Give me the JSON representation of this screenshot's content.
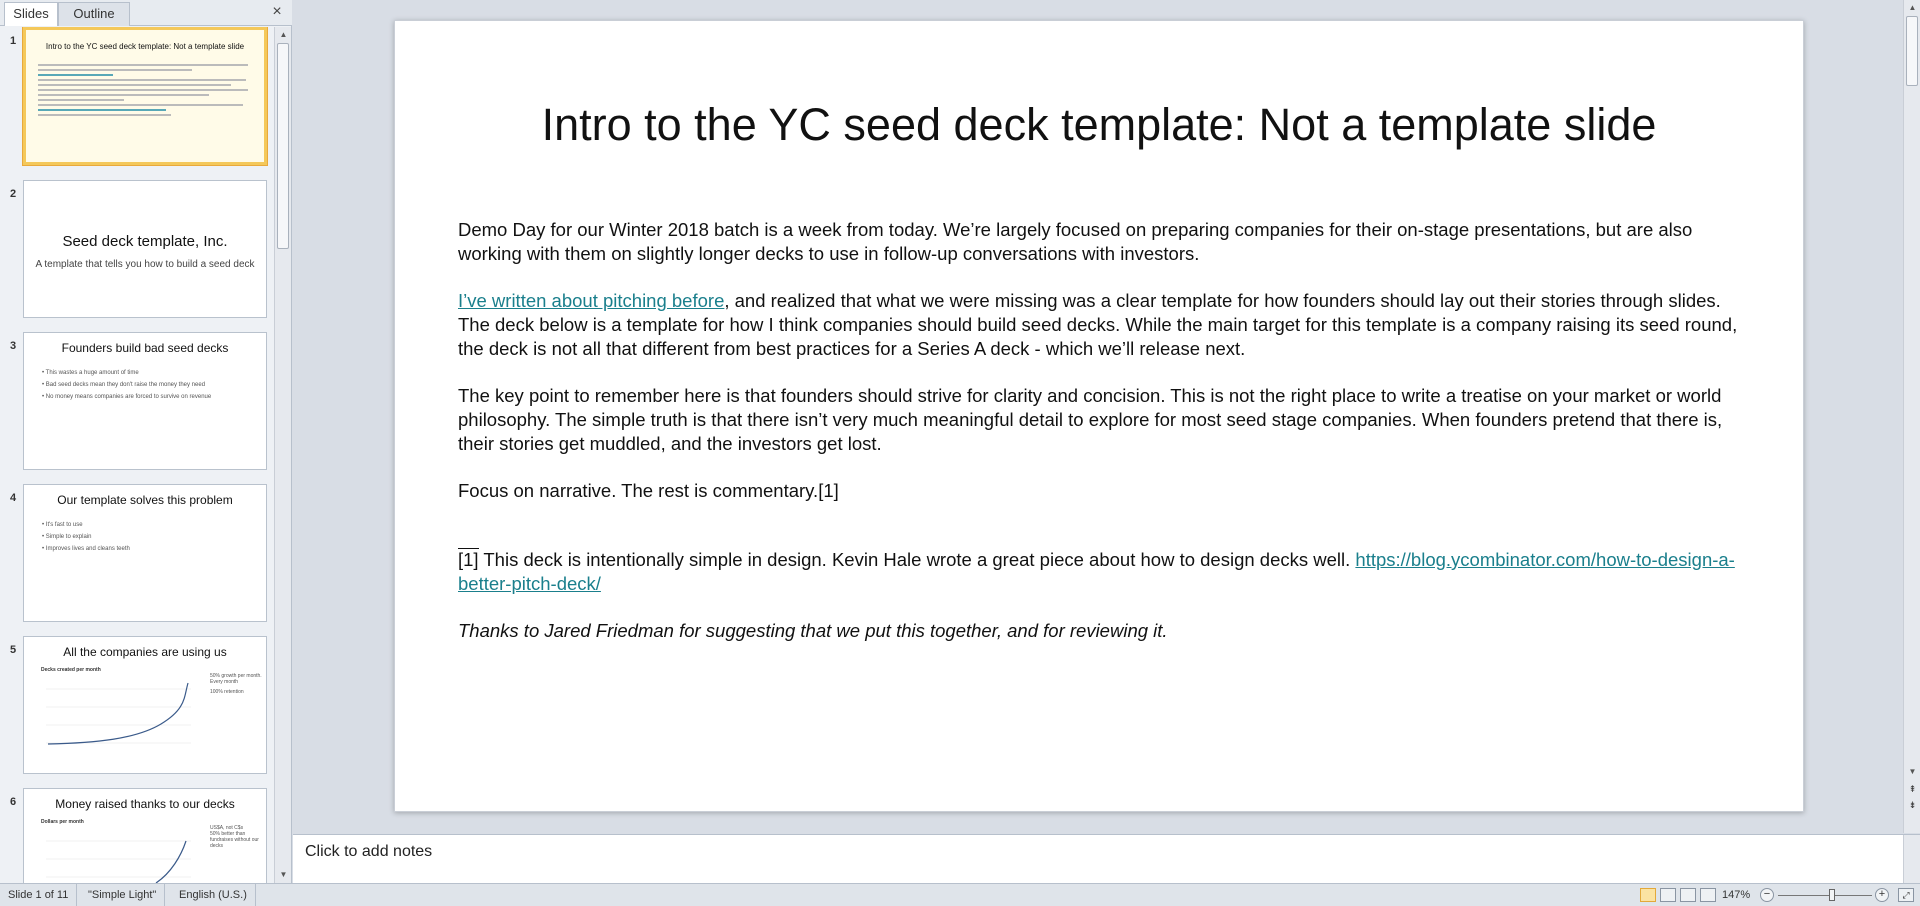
{
  "left_pane": {
    "tabs": [
      "Slides",
      "Outline"
    ],
    "close_symbol": "×"
  },
  "thumbnails": [
    {
      "num": "1",
      "title": "Intro to the YC seed deck template: Not a template slide"
    },
    {
      "num": "2",
      "title": "Seed deck template,  Inc.",
      "subtitle": "A template that tells you how to build a seed deck"
    },
    {
      "num": "3",
      "title": "Founders build bad seed decks",
      "bullets": [
        "This wastes a huge amount of time",
        "Bad seed decks mean they don't raise the money they need",
        "No money means companies are forced to survive on revenue"
      ]
    },
    {
      "num": "4",
      "title": "Our template solves this problem",
      "bullets": [
        "It's fast to use",
        "Simple to explain",
        "Improves lives and cleans teeth"
      ]
    },
    {
      "num": "5",
      "title": "All the companies are using us",
      "chart_caption": "Decks created per month",
      "legend": [
        "50% growth per month. Every month",
        "100% retention"
      ]
    },
    {
      "num": "6",
      "title": "Money raised thanks to our decks",
      "chart_caption": "Dollars per month",
      "legend": [
        "US$A, not C$s",
        "50% better than fundraises without our decks"
      ]
    }
  ],
  "slide": {
    "title": "Intro to the YC seed deck template: Not a template slide",
    "p1": "Demo Day for our Winter 2018 batch is a week from today. We’re largely focused on preparing companies for their on-stage presentations, but are also working with them on slightly longer decks to use in follow-up conversations with investors.",
    "p2_link": "I’ve written about pitching before",
    "p2_rest": ", and realized that what we were missing was a clear template for how founders should lay out their stories through slides. The deck below is a template for how I think companies should build seed decks. While the main target for this template is a company raising its seed round, the deck is not all that different from best practices for a Series A deck - which we’ll release next.",
    "p3": "The key point to remember here is that founders should strive for clarity and concision. This is not the right place to write a treatise on your market or world philosophy. The simple truth is that there isn’t very much meaningful detail to explore for most seed stage companies. When founders pretend that there is, their stories get muddled, and the investors get lost.",
    "p4": "Focus on narrative. The rest is commentary.[1]",
    "fn_ref": "[1]",
    "fn_text": " This deck is intentionally simple in design. Kevin Hale wrote a great piece about how to design decks well. ",
    "fn_link": "https://blog.ycombinator.com/how-to-design-a-better-pitch-deck/",
    "thanks": "Thanks to Jared Friedman for suggesting that we put this together, and for reviewing it."
  },
  "notes": {
    "placeholder": "Click to add notes"
  },
  "status": {
    "slide": "Slide 1 of 11",
    "theme": "\"Simple Light\"",
    "language": "English (U.S.)",
    "zoom": "147%"
  }
}
